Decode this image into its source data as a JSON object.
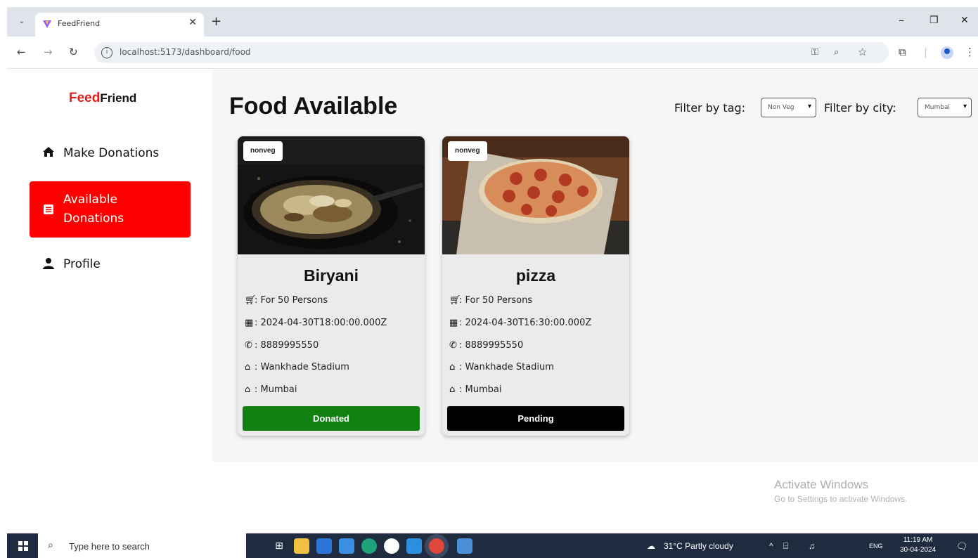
{
  "browser": {
    "tab_title": "FeedFriend",
    "tab_close": "✕",
    "new_tab": "+",
    "url": "localhost:5173/dashboard/food",
    "window_controls": {
      "minimize": "–",
      "restore": "❐",
      "close": "✕"
    }
  },
  "sidebar": {
    "logo_feed": "Feed",
    "logo_friend": "Friend",
    "items": [
      {
        "label": "Make Donations",
        "icon": "home-icon"
      },
      {
        "label": "Available Donations",
        "icon": "list-icon",
        "active": true
      },
      {
        "label": "Profile",
        "icon": "user-icon"
      }
    ]
  },
  "main": {
    "heading": "Food Available",
    "filter_tag_label": "Filter by tag:",
    "filter_tag_value": "Non Veg",
    "filter_city_label": "Filter by city:",
    "filter_city_value": "Mumbai"
  },
  "cards": [
    {
      "tag": "nonveg",
      "title": "Biryani",
      "persons": "For 50 Persons",
      "datetime": "2024-04-30T18:00:00.000Z",
      "phone": "8889995550",
      "location": "Wankhade Stadium",
      "city": "Mumbai",
      "status": "Donated",
      "status_color": "#108010"
    },
    {
      "tag": "nonveg",
      "title": "pizza",
      "persons": "For 50 Persons",
      "datetime": "2024-04-30T16:30:00.000Z",
      "phone": "8889995550",
      "location": "Wankhade Stadium",
      "city": "Mumbai",
      "status": "Pending",
      "status_color": "#000000"
    }
  ],
  "watermark": {
    "line1": "Activate Windows",
    "line2": "Go to Settings to activate Windows."
  },
  "taskbar": {
    "search_placeholder": "Type here to search",
    "weather": "31°C  Partly cloudy",
    "lang": "ENG",
    "time": "11:19 AM",
    "date": "30-04-2024"
  },
  "colors": {
    "accent": "#ff0000",
    "donated": "#108010",
    "pending": "#000000"
  }
}
